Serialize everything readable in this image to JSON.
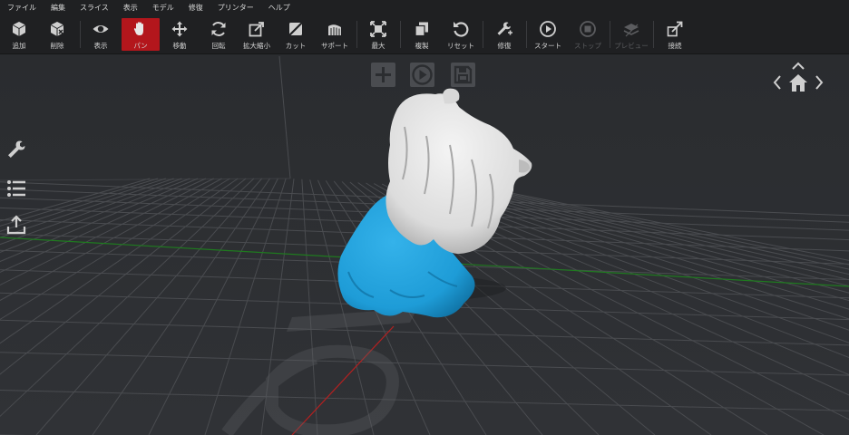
{
  "menu": [
    "ファイル",
    "編集",
    "スライス",
    "表示",
    "モデル",
    "修復",
    "プリンター",
    "ヘルプ"
  ],
  "toolbar": {
    "add": "追加",
    "delete": "削除",
    "view": "表示",
    "pan": "パン",
    "move": "移動",
    "rotate": "回転",
    "scale": "拡大縮小",
    "cut": "カット",
    "support": "サポート",
    "max": "最大",
    "duplicate": "複製",
    "reset": "リセット",
    "repair": "修復",
    "start": "スタート",
    "stop": "ストップ",
    "preview": "プレビュー",
    "connect": "接続"
  },
  "colors": {
    "active_tool": "#b3161c",
    "model_body": "#1e9cd7",
    "model_head": "#e6e6e6",
    "background": "#2c2e31",
    "grid": "#4a4c50",
    "x_axis": "#b52020",
    "y_axis": "#1f7a1f"
  },
  "icons": {
    "viewport_actions": [
      "plus-icon",
      "play-icon",
      "save-icon"
    ],
    "sidebar": [
      "wrench-icon",
      "list-icon",
      "upload-icon"
    ],
    "navigation": [
      "chevron-up-icon",
      "chevron-left-icon",
      "home-icon",
      "chevron-right-icon"
    ]
  }
}
